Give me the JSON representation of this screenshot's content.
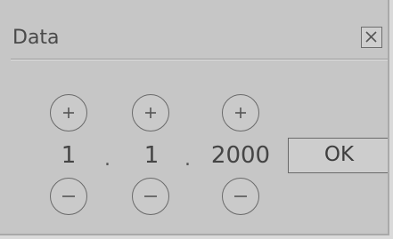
{
  "dialog": {
    "title": "Data",
    "close_icon": "close-icon"
  },
  "fields": [
    {
      "name": "day",
      "value": "1",
      "increment_icon": "plus-icon",
      "decrement_icon": "minus-icon"
    },
    {
      "name": "month",
      "value": "1",
      "increment_icon": "plus-icon",
      "decrement_icon": "minus-icon"
    },
    {
      "name": "year",
      "value": "2000",
      "increment_icon": "plus-icon",
      "decrement_icon": "minus-icon"
    }
  ],
  "separators": [
    ".",
    "."
  ],
  "actions": {
    "ok_label": "OK"
  },
  "colors": {
    "background": "#c6c6c6",
    "text": "#454545",
    "border": "#6a6a6a"
  }
}
